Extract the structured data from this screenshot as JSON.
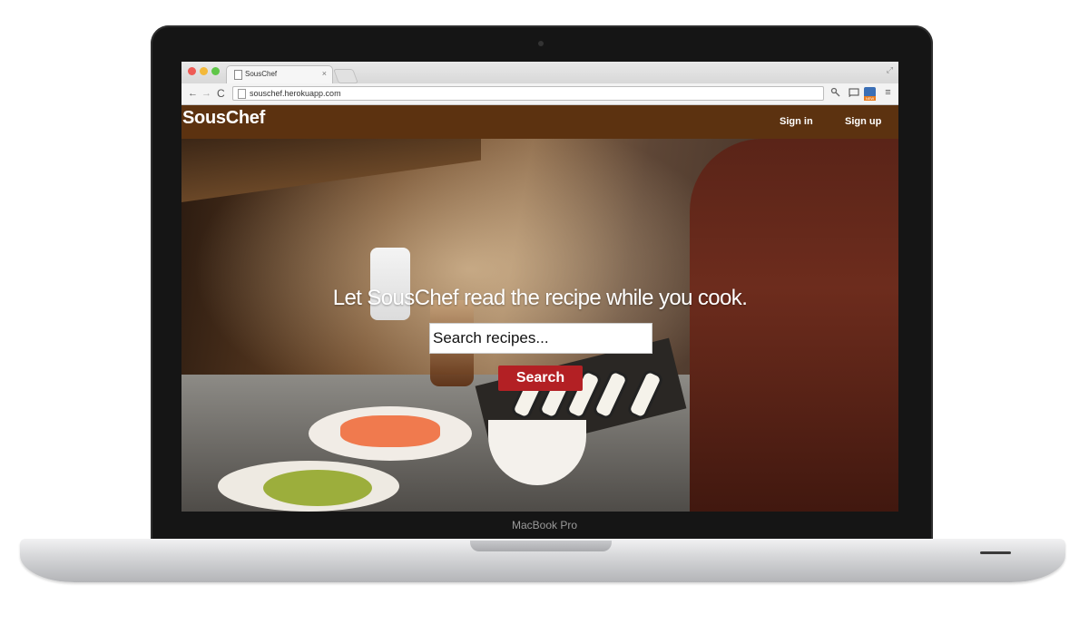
{
  "device": {
    "label": "MacBook Pro"
  },
  "browser": {
    "tab": {
      "title": "SousChef",
      "close_icon": "×",
      "icon": "page-icon"
    },
    "toolbar": {
      "back_icon": "←",
      "forward_icon": "→",
      "reload_icon": "C",
      "url": "souschef.herokuapp.com",
      "menu_icon": "≡"
    },
    "extensions": {
      "new_badge": "NEW"
    },
    "resize_icon": "⤢"
  },
  "site": {
    "header": {
      "logo": "SousChef",
      "nav": [
        {
          "label": "Sign in"
        },
        {
          "label": "Sign up"
        }
      ],
      "background_color": "#5c3210"
    },
    "hero": {
      "tagline": "Let SousChef read the recipe while you cook.",
      "search": {
        "placeholder": "Search recipes...",
        "value": ""
      },
      "search_button_label": "Search",
      "button_color": "#b32024"
    }
  }
}
